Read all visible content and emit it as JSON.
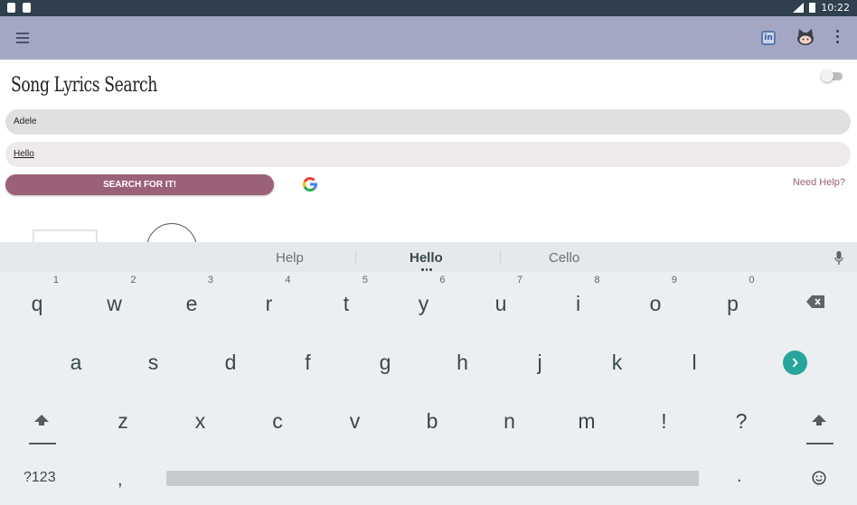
{
  "status_bar": {
    "time": "10:22"
  },
  "toolbar": {
    "menu_icon": "menu-icon",
    "linkedin_icon": "linkedin-icon",
    "github_icon": "github-icon",
    "overflow_icon": "overflow-icon",
    "color": "#a4a7c4"
  },
  "app": {
    "title": "Song Lyrics Search",
    "artist_value": "Adele",
    "song_value": "Hello",
    "search_button_label": "SEARCH FOR IT!",
    "need_help_label": "Need Help?",
    "accent": "#9b6178"
  },
  "keyboard": {
    "suggestions": [
      "Help",
      "Hello",
      "Cello"
    ],
    "row1": [
      {
        "ch": "q",
        "hint": "1"
      },
      {
        "ch": "w",
        "hint": "2"
      },
      {
        "ch": "e",
        "hint": "3"
      },
      {
        "ch": "r",
        "hint": "4"
      },
      {
        "ch": "t",
        "hint": "5"
      },
      {
        "ch": "y",
        "hint": "6"
      },
      {
        "ch": "u",
        "hint": "7"
      },
      {
        "ch": "i",
        "hint": "8"
      },
      {
        "ch": "o",
        "hint": "9"
      },
      {
        "ch": "p",
        "hint": "0"
      }
    ],
    "row2": [
      "a",
      "s",
      "d",
      "f",
      "g",
      "h",
      "j",
      "k",
      "l"
    ],
    "row3": [
      "z",
      "x",
      "c",
      "v",
      "b",
      "n",
      "m",
      "!",
      "?"
    ],
    "symbols_label": "?123",
    "comma_label": ",",
    "period_label": "."
  }
}
